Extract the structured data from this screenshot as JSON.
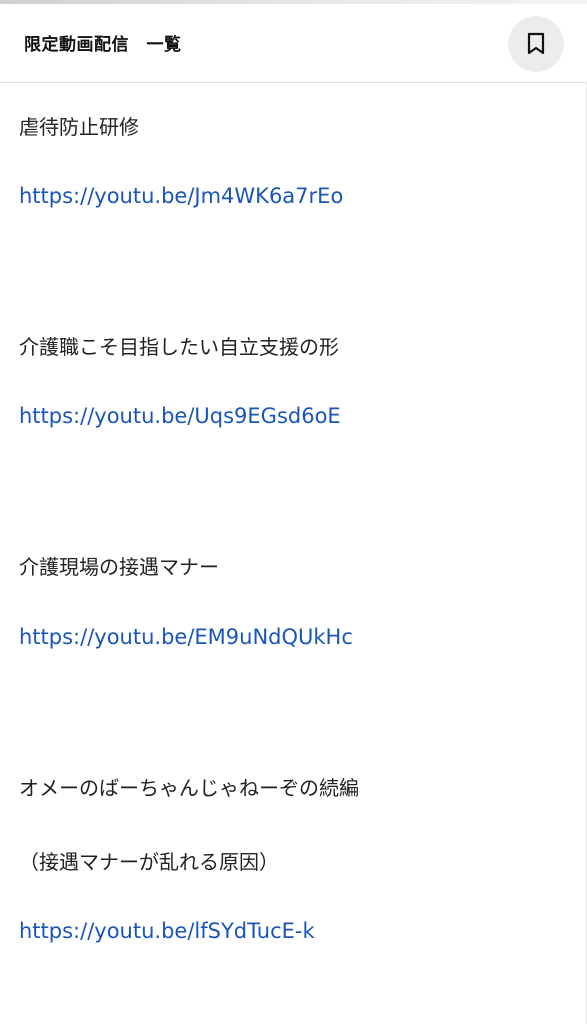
{
  "header": {
    "title": "限定動画配信　一覧",
    "bookmark_icon": "bookmark-icon"
  },
  "entries": [
    {
      "title": "虐待防止研修",
      "url": "https://youtu.be/Jm4WK6a7rEo"
    },
    {
      "title": "介護職こそ目指したい自立支援の形",
      "url": "https://youtu.be/Uqs9EGsd6oE"
    },
    {
      "title": "介護現場の接遇マナー",
      "url": "https://youtu.be/EM9uNdQUkHc"
    },
    {
      "title": "オメーのばーちゃんじゃねーぞの続編",
      "subtitle": "（接遇マナーが乱れる原因）",
      "url": "https://youtu.be/lfSYdTucE-k"
    }
  ],
  "colors": {
    "link": "#1a56b8",
    "text": "#222222",
    "button_bg": "#ececec"
  }
}
